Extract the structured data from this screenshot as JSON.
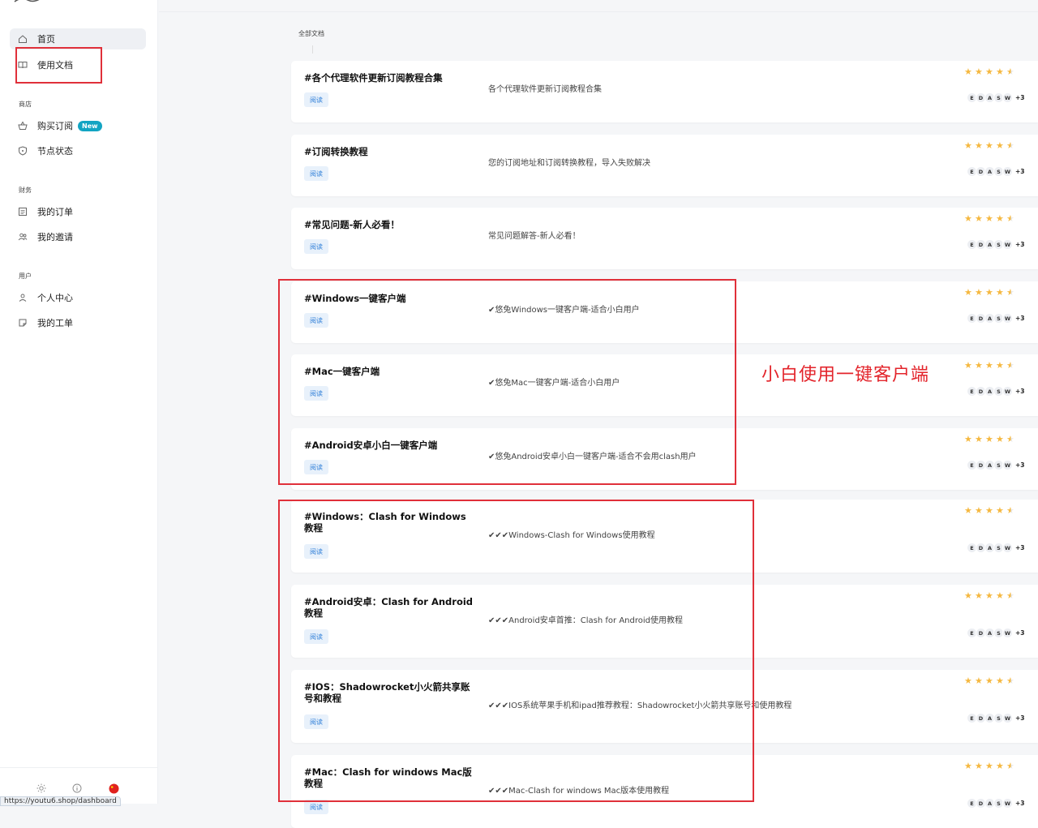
{
  "sidebar": {
    "items": [
      {
        "label": "首页",
        "icon": "home-icon"
      },
      {
        "label": "使用文档",
        "icon": "book-icon"
      },
      {
        "label": "购买订阅",
        "icon": "basket-icon",
        "badge": "New"
      },
      {
        "label": "节点状态",
        "icon": "shield-icon"
      },
      {
        "label": "我的订单",
        "icon": "list-icon"
      },
      {
        "label": "我的邀请",
        "icon": "users-icon"
      },
      {
        "label": "个人中心",
        "icon": "user-icon"
      },
      {
        "label": "我的工单",
        "icon": "ticket-icon"
      }
    ],
    "sections": {
      "shop": "商店",
      "finance": "财务",
      "user": "用户"
    },
    "footer_icons": [
      "sun-icon",
      "info-icon",
      "china-flag-icon"
    ],
    "status_url": "https://youtu6.shop/dashboard"
  },
  "main": {
    "breadcrumb": "全部文档",
    "read_label": "阅读",
    "avatars": [
      "E",
      "D",
      "A",
      "S",
      "W"
    ],
    "avatars_more": "+3",
    "rating": 4.5,
    "docs": [
      {
        "title": "#各个代理软件更新订阅教程合集",
        "desc": "各个代理软件更新订阅教程合集"
      },
      {
        "title": "#订阅转换教程",
        "desc": "您的订阅地址和订阅转换教程，导入失败解决"
      },
      {
        "title": "#常见问题-新人必看！",
        "desc": "常见问题解答-新人必看！"
      },
      {
        "title": "#Windows一键客户端",
        "desc": "✔悠兔Windows一键客户端-适合小白用户"
      },
      {
        "title": "#Mac一键客户端",
        "desc": "✔悠兔Mac一键客户端-适合小白用户"
      },
      {
        "title": "#Android安卓小白一键客户端",
        "desc": "✔悠兔Android安卓小白一键客户端-适合不会用clash用户"
      },
      {
        "title": "#Windows：Clash for Windows教程",
        "desc": "✔✔✔Windows-Clash for Windows使用教程"
      },
      {
        "title": "#Android安卓：Clash for Android教程",
        "desc": "✔✔✔Android安卓首推：Clash for Android使用教程"
      },
      {
        "title": "#IOS：Shadowrocket小火箭共享账号和教程",
        "desc": "✔✔✔IOS系统苹果手机和ipad推荐教程：Shadowrocket小火箭共享账号和使用教程"
      },
      {
        "title": "#Mac：Clash for windows Mac版教程",
        "desc": "✔✔✔Mac-Clash for windows Mac版本使用教程"
      }
    ]
  },
  "annotation": {
    "text": "小白使用一键客户端",
    "color": "#e3242b"
  },
  "colors": {
    "accent": "#2f7fd8",
    "star": "#f5b840",
    "badge": "#12a4c3",
    "highlight": "#e0303a"
  }
}
